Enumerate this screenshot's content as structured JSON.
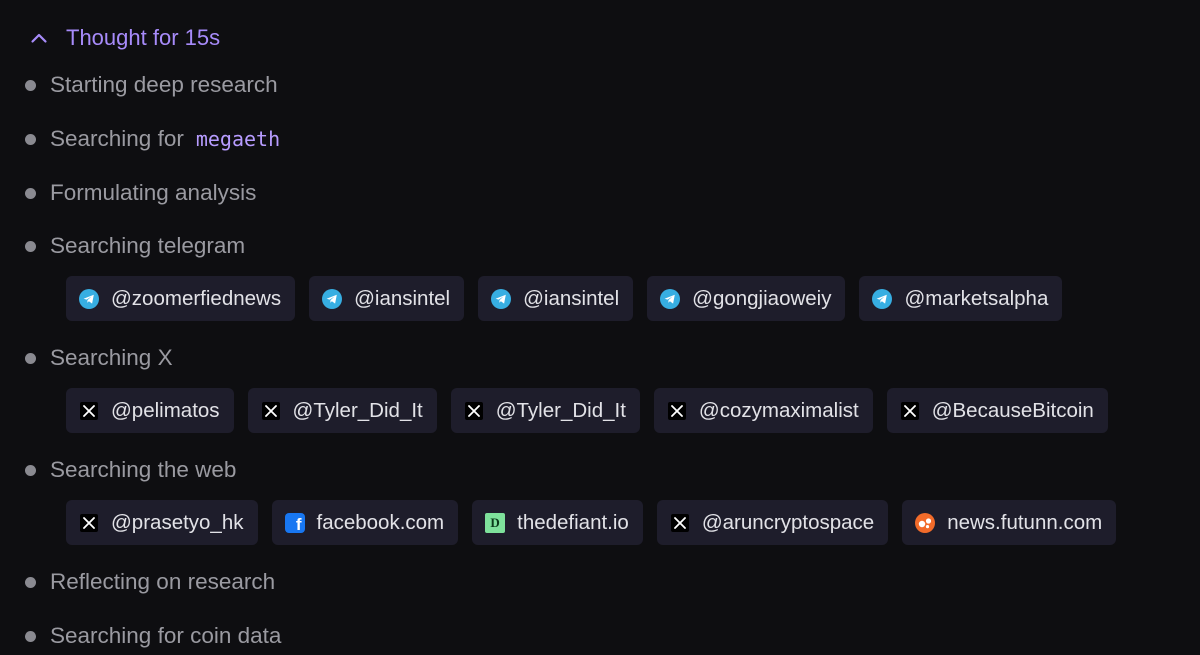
{
  "header": {
    "label": "Thought for 15s",
    "icon": "chevron-up-icon"
  },
  "steps": [
    {
      "text": "Starting deep research"
    },
    {
      "text": "Searching for",
      "query": "megaeth"
    },
    {
      "text": "Formulating analysis"
    },
    {
      "text": "Searching telegram"
    },
    {
      "text": "Searching X"
    },
    {
      "text": "Searching the web"
    },
    {
      "text": "Reflecting on research"
    },
    {
      "text": "Searching for coin data"
    }
  ],
  "telegram_sources": [
    {
      "label": "@zoomerfiednews",
      "icon": "telegram-icon"
    },
    {
      "label": "@iansintel",
      "icon": "telegram-icon"
    },
    {
      "label": "@iansintel",
      "icon": "telegram-icon"
    },
    {
      "label": "@gongjiaoweiy",
      "icon": "telegram-icon"
    },
    {
      "label": "@marketsalpha",
      "icon": "telegram-icon"
    }
  ],
  "x_sources": [
    {
      "label": "@pelimatos",
      "icon": "x-icon"
    },
    {
      "label": "@Tyler_Did_It",
      "icon": "x-icon"
    },
    {
      "label": "@Tyler_Did_It",
      "icon": "x-icon"
    },
    {
      "label": "@cozymaximalist",
      "icon": "x-icon"
    },
    {
      "label": "@BecauseBitcoin",
      "icon": "x-icon"
    }
  ],
  "web_sources": [
    {
      "label": "@prasetyo_hk",
      "icon": "x-icon"
    },
    {
      "label": "facebook.com",
      "icon": "facebook-icon"
    },
    {
      "label": "thedefiant.io",
      "icon": "thedefiant-icon"
    },
    {
      "label": "@aruncryptospace",
      "icon": "x-icon"
    },
    {
      "label": "news.futunn.com",
      "icon": "futunn-icon"
    }
  ],
  "colors": {
    "background": "#0e0e11",
    "accent": "#a78bfa",
    "chip_background": "#1e1d2b",
    "step_text": "#9a9aa1",
    "telegram": "#37aee2",
    "facebook": "#1877f2"
  }
}
